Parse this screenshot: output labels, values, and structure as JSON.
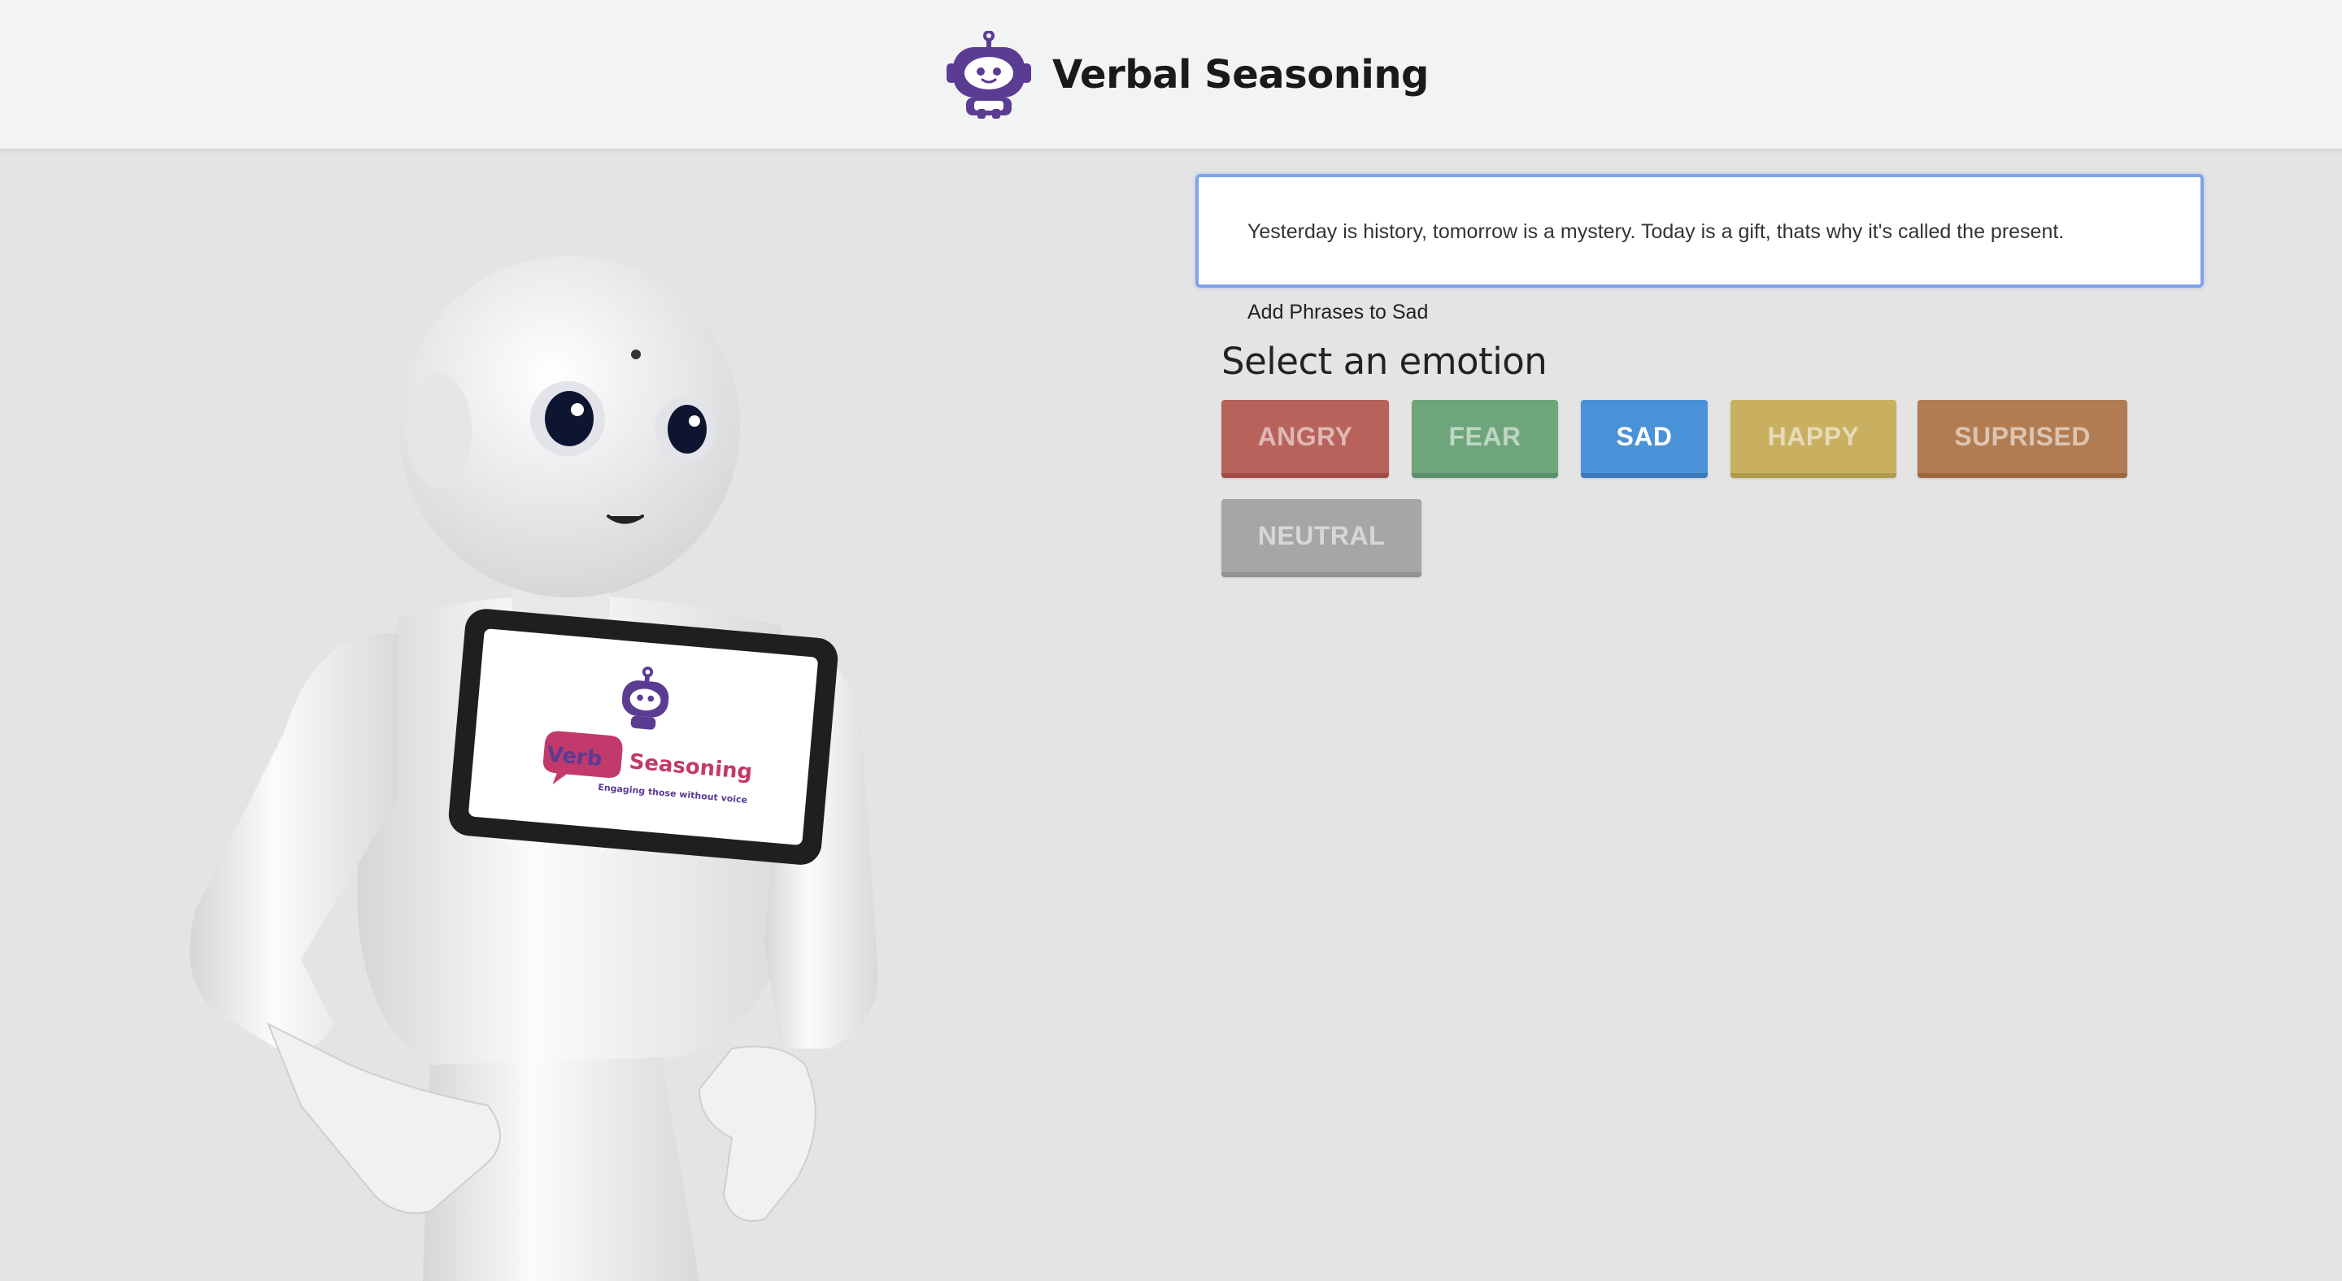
{
  "header": {
    "title": "Verbal Seasoning",
    "logo_icon": "robot-logo-icon"
  },
  "robot_image": {
    "screen_logo_text_a": "Verb",
    "screen_logo_text_b": "al Seasoning",
    "screen_logo_tagline": "Engaging those without voice"
  },
  "editor": {
    "phrase_text": "Yesterday is history, tomorrow is a mystery. Today is a gift, thats why it's called the present.",
    "add_label": "Add Phrases to Sad"
  },
  "emotions": {
    "title": "Select an emotion",
    "selected": "SAD",
    "buttons": [
      {
        "label": "ANGRY",
        "color": "#b7625a",
        "border": "#a24c45"
      },
      {
        "label": "FEAR",
        "color": "#6ea57b",
        "border": "#5a9068"
      },
      {
        "label": "SAD",
        "color": "#4a92d8",
        "border": "#3a78b8"
      },
      {
        "label": "HAPPY",
        "color": "#c8b060",
        "border": "#b09a4c"
      },
      {
        "label": "SUPRISED",
        "color": "#b27c53",
        "border": "#9c6840"
      },
      {
        "label": "NEUTRAL",
        "color": "#a5a6a8",
        "border": "#919294"
      }
    ]
  },
  "colors": {
    "brand_purple": "#5b3c93",
    "brand_pink": "#c23a6c",
    "focus_blue": "#7ea3ec"
  }
}
